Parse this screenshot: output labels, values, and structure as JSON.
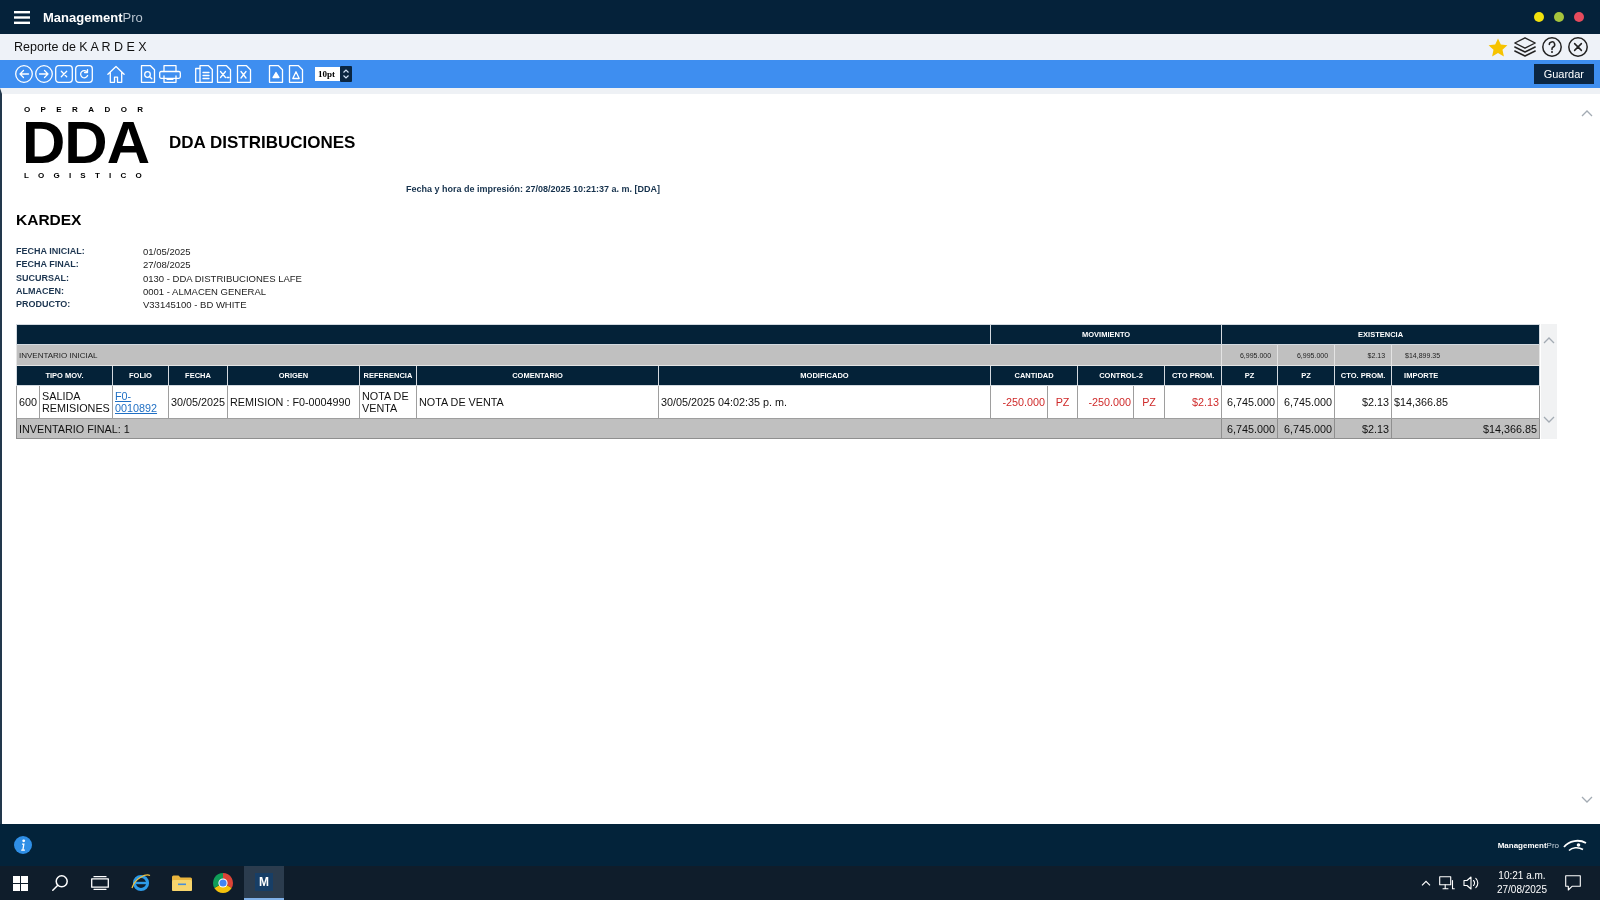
{
  "app_bar": {
    "brand": "**Management**Pro",
    "window_controls": [
      {
        "color": "#f2e20c"
      },
      {
        "color": "#a6c43c"
      },
      {
        "color": "#e64b5d"
      }
    ]
  },
  "title_bar": {
    "title": "Reporte de K A R D E X",
    "favorite": true
  },
  "toolbar": {
    "font_size": "10pt",
    "save_button": "Guardar"
  },
  "report": {
    "logo": {
      "top": "OPERADOR",
      "mark": "DDA",
      "bottom": "LOGISTICO"
    },
    "company": "DDA DISTRIBUCIONES",
    "printed_at": "Fecha y hora de impresión: 27/08/2025 10:21:37 a. m. [DDA]",
    "title": "KARDEX",
    "filters": [
      {
        "label": "FECHA INICIAL:",
        "value": "01/05/2025"
      },
      {
        "label": "FECHA FINAL:",
        "value": "27/08/2025"
      },
      {
        "label": "SUCURSAL:",
        "value": "0130 - DDA DISTRIBUCIONES LAFE"
      },
      {
        "label": "ALMACEN:",
        "value": "0001 - ALMACEN GENERAL"
      },
      {
        "label": "PRODUCTO:",
        "value": "V33145100 - BD WHITE"
      }
    ]
  },
  "table": {
    "group_headers": [
      "MOVIMIENTO",
      "EXISTENCIA"
    ],
    "opening": {
      "label": "INVENTARIO INICIAL",
      "stock": [
        "6,995.000",
        "6,995.000",
        "$2.13",
        "$14,899.35"
      ]
    },
    "columns": [
      "TIPO MOV.",
      "FOLIO",
      "FECHA",
      "ORIGEN",
      "REFERENCIA",
      "COMENTARIO",
      "MODIFICADO",
      "CANTIDAD",
      "CONTROL-2",
      "CTO PROM.",
      "PZ",
      "PZ",
      "CTO. PROM.",
      "IMPORTE"
    ],
    "rows": [
      {
        "outgoing": true,
        "cells": [
          [
            "600",
            "SALIDA REMISIONES"
          ],
          "F0-0010892",
          "30/05/2025",
          "REMISION : F0-0004990",
          "NOTA DE VENTA",
          "NOTA DE VENTA",
          "30/05/2025 04:02:35 p. m.",
          [
            "-250.000",
            "PZ"
          ],
          [
            "-250.000",
            "PZ"
          ],
          "$2.13",
          "6,745.000",
          "6,745.000",
          "$2.13",
          "$14,366.85"
        ]
      }
    ],
    "closing": {
      "label": "INVENTARIO FINAL: 1",
      "stock": [
        "6,745.000",
        "6,745.000",
        "$2.13",
        "$14,366.85"
      ]
    }
  },
  "footer": {
    "brand": "**Management**Pro"
  },
  "taskbar": {
    "apps": [
      {
        "kind": "ring",
        "selected": false
      },
      {
        "kind": "folder",
        "selected": false
      },
      {
        "kind": "tricolor",
        "selected": false
      },
      {
        "kind": "tile",
        "label": "M",
        "selected": true
      }
    ],
    "time": "10:21 a.m.",
    "date": "27/08/2025"
  }
}
